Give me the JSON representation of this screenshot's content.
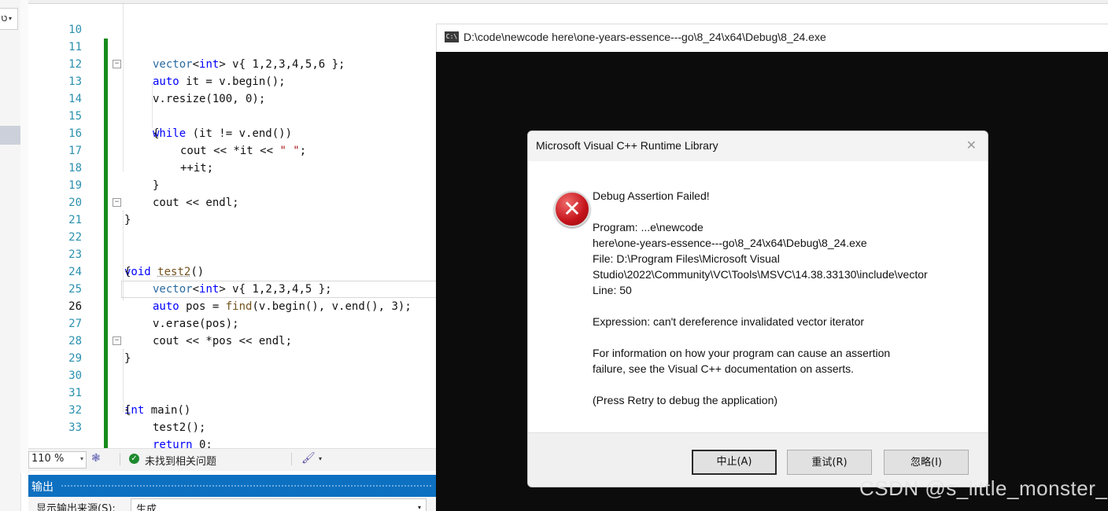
{
  "left_panel": {
    "dropdown_glyph": "ט"
  },
  "editor": {
    "lines": [
      {
        "n": "10"
      },
      {
        "n": "11"
      },
      {
        "n": "12"
      },
      {
        "n": "13"
      },
      {
        "n": "14"
      },
      {
        "n": "15"
      },
      {
        "n": "16"
      },
      {
        "n": "17"
      },
      {
        "n": "18"
      },
      {
        "n": "19"
      },
      {
        "n": "20"
      },
      {
        "n": "21"
      },
      {
        "n": "22"
      },
      {
        "n": "23"
      },
      {
        "n": "24"
      },
      {
        "n": "25"
      },
      {
        "n": "26"
      },
      {
        "n": "27"
      },
      {
        "n": "28"
      },
      {
        "n": "29"
      },
      {
        "n": "30"
      },
      {
        "n": "31"
      },
      {
        "n": "32"
      },
      {
        "n": "33"
      }
    ],
    "code": {
      "l10": {
        "t1": "vector",
        "t2": "<",
        "t3": "int",
        "t4": "> v{ 1,2,3,4,5,6 };"
      },
      "l11": {
        "t1": "auto",
        "t2": " it = v.begin();"
      },
      "l12": {
        "t1": "v.resize(100, 0);"
      },
      "l13": {
        "t1": "while",
        "t2": " (it != v.end())"
      },
      "l14": {
        "t1": "{"
      },
      "l15": {
        "t1": "cout << *it << ",
        "t2": "\" \"",
        "t3": ";"
      },
      "l16": {
        "t1": "++it;"
      },
      "l17": {
        "t1": "}"
      },
      "l18": {
        "t1": "cout << endl;"
      },
      "l19": {
        "t1": "}"
      },
      "l21": {
        "t1": "void",
        "t2": " ",
        "t3": "test2",
        "t4": "()"
      },
      "l22": {
        "t1": "{"
      },
      "l23": {
        "t1": "vector",
        "t2": "<",
        "t3": "int",
        "t4": "> v{ 1,2,3,4,5 };"
      },
      "l24": {
        "t1": "auto",
        "t2": " pos = ",
        "t3": "find",
        "t4": "(v.begin(), v.end(), 3);"
      },
      "l25": {
        "t1": "v.erase(pos);"
      },
      "l26": {
        "t1": "cout << *pos << endl;"
      },
      "l27": {
        "t1": "}"
      },
      "l29": {
        "t1": "int",
        "t2": " main()"
      },
      "l30": {
        "t1": "{"
      },
      "l31": {
        "t1": "test2();"
      },
      "l32": {
        "t1": "return",
        "t2": " 0;"
      },
      "l33": {
        "t1": "}"
      },
      "fold_sign": "−"
    },
    "current_line": "26"
  },
  "status_bar": {
    "zoom": "110 %",
    "zoom_arrow": "▾",
    "ok_glyph": "✓",
    "message": "未找到相关问题",
    "brush_glyph": "🖌",
    "brush_arrow": "▾",
    "blame_glyph": "❃"
  },
  "output_panel": {
    "title": "输出",
    "source_label": "显示输出来源(S):",
    "source_value": "生成",
    "dd_arrow": "▾"
  },
  "console": {
    "icon_text": "C:\\",
    "title": "D:\\code\\newcode here\\one-years-essence---go\\8_24\\x64\\Debug\\8_24.exe"
  },
  "dialog": {
    "title": "Microsoft Visual C++ Runtime Library",
    "close_glyph": "✕",
    "error_glyph": "✕",
    "heading": "Debug Assertion Failed!",
    "program_line1": "Program: ...e\\newcode",
    "program_line2": "here\\one-years-essence---go\\8_24\\x64\\Debug\\8_24.exe",
    "file_line1": "File: D:\\Program Files\\Microsoft Visual",
    "file_line2": "Studio\\2022\\Community\\VC\\Tools\\MSVC\\14.38.33130\\include\\vector",
    "line": "Line: 50",
    "expression": "Expression: can't dereference invalidated vector iterator",
    "info_line1": "For information on how your program can cause an assertion",
    "info_line2": "failure, see the Visual C++ documentation on asserts.",
    "press_retry": "(Press Retry to debug the application)",
    "buttons": {
      "abort": "中止(A)",
      "retry": "重试(R)",
      "ignore": "忽略(I)"
    }
  },
  "watermark": "CSDN @s_little_monster_"
}
